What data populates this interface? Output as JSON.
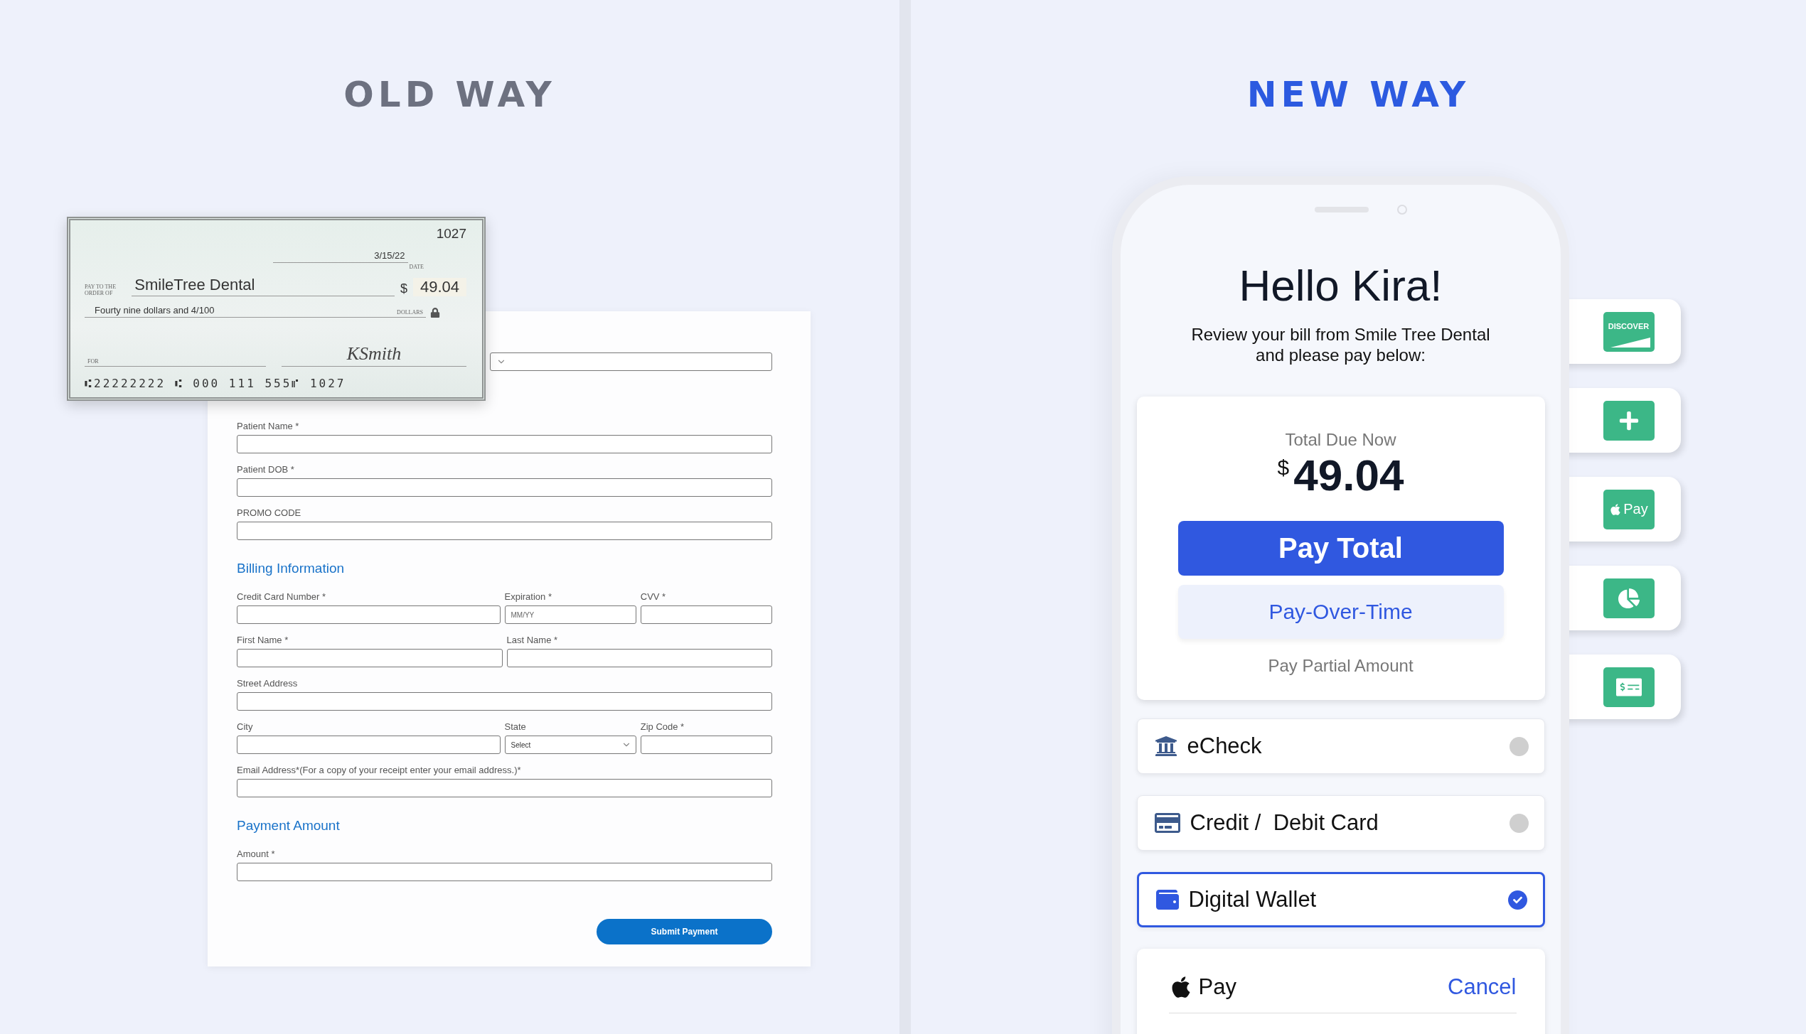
{
  "old_way": {
    "title": "OLD WAY",
    "check": {
      "number": "1027",
      "date": "3/15/22",
      "date_caption": "DATE",
      "pay_to_caption": "PAY TO THE ORDER OF",
      "payee": "SmileTree Dental",
      "currency": "$",
      "amount": "49.04",
      "amount_words": "Fourty nine dollars and 4/100",
      "dollars_caption": "DOLLARS",
      "for_caption": "FOR",
      "signature": "KSmith",
      "micr_line": "⑆22222222 ⑆ 000 111 555⑈ 1027"
    },
    "form": {
      "rows": [
        {
          "kind": "fields",
          "fields": [
            {
              "kind": "select"
            }
          ]
        },
        {
          "kind": "fields",
          "fields": [
            {
              "kind": "input",
              "label": "Patient Name *"
            }
          ]
        },
        {
          "kind": "fields",
          "fields": [
            {
              "kind": "input",
              "label": "Patient DOB *"
            }
          ]
        },
        {
          "kind": "fields",
          "fields": [
            {
              "kind": "input",
              "label": "PROMO CODE"
            }
          ]
        },
        {
          "kind": "heading",
          "text": "Billing Information"
        },
        {
          "kind": "fields",
          "fields": [
            {
              "kind": "input",
              "label": "Credit Card Number *"
            },
            {
              "kind": "input",
              "label": "Expiration *",
              "placeholder": "MM/YY"
            },
            {
              "kind": "input",
              "label": "CVV *"
            }
          ]
        },
        {
          "kind": "fields",
          "fields": [
            {
              "kind": "input",
              "label": "First Name *"
            },
            {
              "kind": "input",
              "label": "Last Name *"
            }
          ]
        },
        {
          "kind": "fields",
          "fields": [
            {
              "kind": "input",
              "label": "Street Address"
            }
          ]
        },
        {
          "kind": "fields",
          "fields": [
            {
              "kind": "input",
              "label": "City"
            },
            {
              "kind": "select",
              "label": "State",
              "value": "Select"
            },
            {
              "kind": "input",
              "label": "Zip Code *"
            }
          ]
        },
        {
          "kind": "fields",
          "fields": [
            {
              "kind": "input",
              "label": "Email Address*(For a copy of your receipt enter your email address.)*"
            }
          ]
        },
        {
          "kind": "heading",
          "text": "Payment Amount"
        },
        {
          "kind": "fields",
          "fields": [
            {
              "kind": "input",
              "label": "Amount *"
            }
          ]
        }
      ],
      "submit": "Submit Payment"
    }
  },
  "new_way": {
    "title": "NEW WAY",
    "phone": {
      "greeting": "Hello Kira!",
      "message_lines": [
        "Review your bill from Smile Tree Dental",
        "and please pay below:"
      ],
      "total_label": "Total Due Now",
      "currency": "$",
      "total": "49.04",
      "actions": [
        {
          "kind": "primary",
          "label": "Pay Total"
        },
        {
          "kind": "secondary",
          "label": "Pay-Over-Time"
        },
        {
          "kind": "link",
          "label": "Pay Partial Amount"
        }
      ],
      "methods": [
        {
          "kind": "bank",
          "label": "eCheck",
          "selected": false
        },
        {
          "kind": "card",
          "label": "Credit /  Debit Card",
          "selected": false
        },
        {
          "kind": "wallet",
          "label": "Digital Wallet",
          "selected": true
        }
      ],
      "wallet_sheet": {
        "label": "Pay",
        "cancel": "Cancel"
      }
    },
    "side_icons": [
      {
        "kind": "discover",
        "text": "DISCOVER"
      },
      {
        "kind": "plus"
      },
      {
        "kind": "applepay",
        "text": "Pay"
      },
      {
        "kind": "pie"
      },
      {
        "kind": "check"
      }
    ]
  }
}
